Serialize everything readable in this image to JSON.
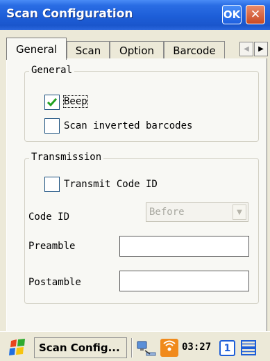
{
  "window": {
    "title": "Scan Configuration",
    "ok_label": "OK",
    "close_label": "✕"
  },
  "tabs": [
    {
      "label": "General",
      "active": true
    },
    {
      "label": "Scan",
      "active": false
    },
    {
      "label": "Option",
      "active": false
    },
    {
      "label": "Barcode",
      "active": false
    }
  ],
  "tab_scroll": {
    "left_arrow": "◀",
    "right_arrow": "▶"
  },
  "general_group": {
    "title": "General",
    "beep": {
      "label": "Beep",
      "checked": true
    },
    "scan_inverted": {
      "label": "Scan inverted barcodes",
      "checked": false
    }
  },
  "transmission_group": {
    "title": "Transmission",
    "transmit_code_id": {
      "label": "Transmit Code ID",
      "checked": false
    },
    "code_id": {
      "label": "Code ID",
      "value": "Before",
      "enabled": false,
      "arrow": "▼"
    },
    "preamble": {
      "label": "Preamble",
      "value": ""
    },
    "postamble": {
      "label": "Postamble",
      "value": ""
    }
  },
  "taskbar": {
    "app_label": "Scan Config...",
    "clock": "03:27",
    "badge": "1"
  },
  "colors": {
    "title_bar": "#1d5ed8",
    "close_button": "#c94a24",
    "checkmark": "#21a121",
    "panel": "#f8f8f4",
    "chrome": "#ece9d8"
  }
}
